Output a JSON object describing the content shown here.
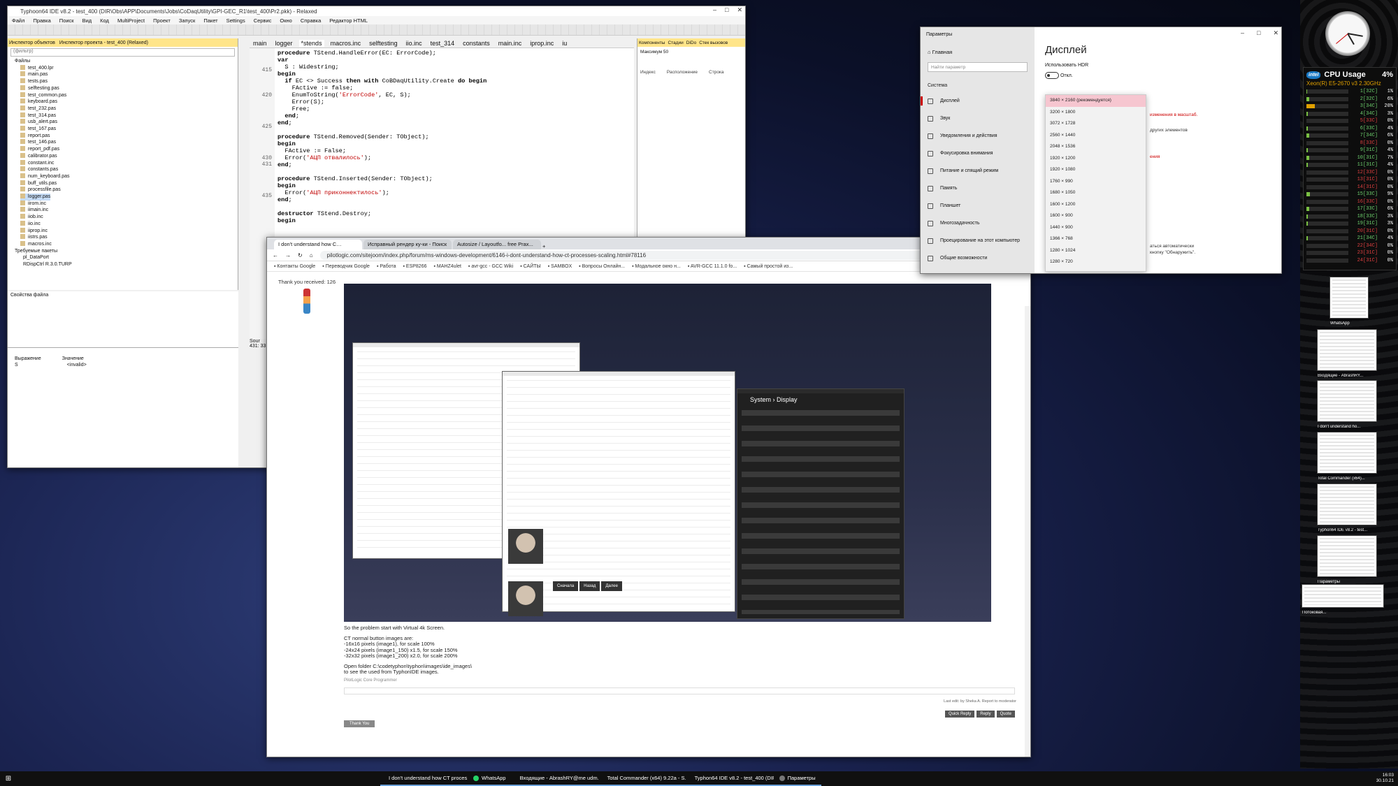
{
  "ide": {
    "title": "Typhoon64 IDE v8.2 - test_400 (DIR\\Obs\\APP\\Documents\\Jobs\\CoDaqUtility\\GPI-GEC_R1\\test_400\\Pr2.pkk) - Relaxed",
    "menu": [
      "Файл",
      "Правка",
      "Поиск",
      "Вид",
      "Код",
      "MultiProject",
      "Проект",
      "Запуск",
      "Пакет",
      "Settings",
      "Сервис",
      "Окно",
      "Справка",
      "Редактор HTML"
    ],
    "left_tabs": [
      "Инспектор объектов",
      "Инспектор проекта - test_400 (Relaxed)"
    ],
    "filter_placeholder": "(фильтр)",
    "files_root": "Файлы",
    "files": [
      "test_400.lpr",
      "main.pas",
      "tests.pas",
      "selftesting.pas",
      "test_common.pas",
      "keyboard.pas",
      "test_232.pas",
      "test_314.pas",
      "usb_alert.pas",
      "test_167.pas",
      "report.pas",
      "test_146.pas",
      "report_pdf.pas",
      "calibrator.pas",
      "constant.inc",
      "constants.pas",
      "num_keyboard.pas",
      "buff_utils.pas",
      "processfile.pas",
      "logger.pas",
      "iirom.inc",
      "iimain.inc",
      "iiob.inc",
      "iio.inc",
      "iiprop.inc",
      "iistrs.pas",
      "macros.inc"
    ],
    "selected_file": "logger.pas",
    "packages_label": "Требуемые пакеты",
    "packages": [
      "pl_DataPort",
      "RDispCtrl R.3.0.TURP"
    ],
    "file_props": "Свойства файла",
    "editor_tabs": [
      "main",
      "logger",
      "*stends",
      "macros.inc",
      "selftesting",
      "iio.inc",
      "test_314",
      "constants",
      "main.inc",
      "iprop.inc",
      "iu"
    ],
    "active_tab": "*stends",
    "line_numbers": [
      "",
      "",
      "",
      "415",
      "",
      "",
      "",
      "420",
      "",
      "",
      "",
      "",
      "425",
      "",
      "",
      "",
      "",
      "430",
      "431",
      "",
      "",
      "",
      "",
      "435"
    ],
    "code": [
      {
        "t": "procedure TStend.HandleError(EC: ErrorCode);"
      },
      {
        "t": "var"
      },
      {
        "t": "  S : Widestring;"
      },
      {
        "t": "begin"
      },
      {
        "t": "  if EC <> Success then with CoBDaqUtility.Create do begin"
      },
      {
        "t": "    FActive := false;"
      },
      {
        "t": "    EnumToString('ErrorCode', EC, S);"
      },
      {
        "t": "    Error(S);"
      },
      {
        "t": "    Free;"
      },
      {
        "t": "  end;"
      },
      {
        "t": "end;"
      },
      {
        "t": ""
      },
      {
        "t": "procedure TStend.Removed(Sender: TObject);"
      },
      {
        "t": "begin"
      },
      {
        "t": "  FActive := False;"
      },
      {
        "t": "  Error('АЦП отвалилось');"
      },
      {
        "t": "end;"
      },
      {
        "t": ""
      },
      {
        "t": "procedure TStend.Inserted(Sender: TObject);"
      },
      {
        "t": "begin"
      },
      {
        "t": "  Error('АЦП приконнектилось');"
      },
      {
        "t": "end;"
      },
      {
        "t": ""
      },
      {
        "t": "destructor TStend.Destroy;"
      },
      {
        "t": "begin"
      }
    ],
    "cursor_pos": "431: 33",
    "source_label": "Sour",
    "right_tabs": [
      "Компоненты",
      "Стадии",
      "DiDo",
      "Стек вызовов"
    ],
    "right_max": "Максимум 50",
    "right_cols": [
      "Индекс",
      "Расположение",
      "Строка"
    ],
    "watch_cols": [
      "Выражение",
      "Значение"
    ],
    "watch_row": [
      "S",
      "<invalid>"
    ]
  },
  "browser": {
    "tabs": [
      "I don't understand how C…",
      "Исправный рендер ку-ки - Поиск",
      "Autosize / Layoutfo... free Prax..."
    ],
    "url": "pilotlogic.com/sitejoom/index.php/forum/ms-windows-development/6146-i-dont-understand-how-ct-processes-scaling.html#78116",
    "bookmarks": [
      "Контакты Google",
      "Переводчик Google",
      "Работа",
      "ESP8266",
      "MAHZ4ulet",
      "avr-gcc - GCC Wiki",
      "САЙТЫ",
      "SAMBOX",
      "Вопросы Онлайн...",
      "Модальное окно н...",
      "AVR-GCC 11.1.0 fo...",
      "Самый простой из..."
    ],
    "thanks_text": "Thank you received: 126",
    "inner_title": "System  ›  Display",
    "inner_btns": [
      "Сначала",
      "Назад",
      "Далее"
    ],
    "post_lines": [
      "So the problem start with Virtual 4k Screen.",
      "CT normal button images are:",
      "-16x16 pixels (image1), for scale 100%",
      "-24x24 pixels (image1_150) x1.5, for scale 150%",
      "-32x32 pixels (image1_200) x2.0, for scale 200%",
      "Open folder C:\\codetyphon\\typhon\\images\\ide_images\\",
      "to see the used from TyphonIDE images."
    ],
    "signature": "PilotLogic Core Programmer",
    "last_edit": "Last edit: by Sheka A.      Report to moderator",
    "actions": [
      "Quick Reply",
      "Reply",
      "Quote"
    ],
    "thank_btn": "Thank You"
  },
  "settings": {
    "app": "Параметры",
    "home": "Главная",
    "search_placeholder": "Найти параметр",
    "section": "Система",
    "items": [
      "Дисплей",
      "Звук",
      "Уведомления и действия",
      "Фокусировка внимания",
      "Питание и спящий режим",
      "Память",
      "Планшет",
      "Многозадачность",
      "Проецирование на этот компьютер",
      "Общие возможности"
    ],
    "active_item": 0,
    "title": "Дисплей",
    "hdr_label": "Использовать HDR",
    "hdr_state": "Откл.",
    "resolutions": [
      "3840 × 2160 (рекомендуется)",
      "3200 × 1800",
      "3072 × 1728",
      "2560 × 1440",
      "2048 × 1536",
      "1920 × 1200",
      "1920 × 1080",
      "1760 × 990",
      "1680 × 1050",
      "1600 × 1200",
      "1600 × 900",
      "1440 × 900",
      "1366 × 768",
      "1280 × 1024",
      "1280 × 720"
    ],
    "selected_resolution": 0,
    "red_note1": "изменения в масштаб.",
    "note2": "других элементов",
    "red_note3": "ения",
    "note4a": "аться автоматически",
    "note4b": "кнопку \"Обнаружить\"."
  },
  "cpu": {
    "title": "CPU Usage",
    "total": "4%",
    "model": "Xeon(R) E5-2670 v3 2.30GHz",
    "brand": "intel",
    "cores": [
      {
        "n": "1[32C]",
        "p": "1%",
        "v": 1
      },
      {
        "n": "2[32C]",
        "p": "6%",
        "v": 6
      },
      {
        "n": "3[34C]",
        "p": "20%",
        "v": 20
      },
      {
        "n": "4[34C]",
        "p": "3%",
        "v": 3
      },
      {
        "n": "5[33C]",
        "p": "0%",
        "v": 0
      },
      {
        "n": "6[33C]",
        "p": "4%",
        "v": 4
      },
      {
        "n": "7[34C]",
        "p": "6%",
        "v": 6
      },
      {
        "n": "8[33C]",
        "p": "0%",
        "v": 0
      },
      {
        "n": "9[31C]",
        "p": "4%",
        "v": 4
      },
      {
        "n": "10[31C]",
        "p": "7%",
        "v": 7
      },
      {
        "n": "11[31C]",
        "p": "4%",
        "v": 4
      },
      {
        "n": "12[33C]",
        "p": "0%",
        "v": 0
      },
      {
        "n": "13[31C]",
        "p": "0%",
        "v": 0
      },
      {
        "n": "14[31C]",
        "p": "0%",
        "v": 0
      },
      {
        "n": "15[33C]",
        "p": "9%",
        "v": 9
      },
      {
        "n": "16[33C]",
        "p": "0%",
        "v": 0
      },
      {
        "n": "17[33C]",
        "p": "6%",
        "v": 6
      },
      {
        "n": "18[33C]",
        "p": "3%",
        "v": 3
      },
      {
        "n": "19[31C]",
        "p": "3%",
        "v": 3
      },
      {
        "n": "20[31C]",
        "p": "0%",
        "v": 0
      },
      {
        "n": "21[34C]",
        "p": "4%",
        "v": 4
      },
      {
        "n": "22[34C]",
        "p": "0%",
        "v": 0
      },
      {
        "n": "23[31C]",
        "p": "0%",
        "v": 0
      },
      {
        "n": "24[31C]",
        "p": "0%",
        "v": 0
      }
    ]
  },
  "thumbnails": [
    "WhatsApp",
    "Входящие - AbrashRY...",
    "I don't understand ho...",
    "Total Commander (x64)...",
    "Typhon64 IDE v8.2 - test...",
    "Параметры",
    "Потоковая..."
  ],
  "taskbar": {
    "apps": [
      "I don't understand how CT proces...",
      "WhatsApp",
      "Входящие - AbrashRY@me udm...",
      "Total Commander (x64) 9.22a - S...",
      "Typhon64 IDE v8.2 - test_400 (DIR...",
      "Параметры"
    ],
    "time": "16:03",
    "date": "30.10.21"
  }
}
